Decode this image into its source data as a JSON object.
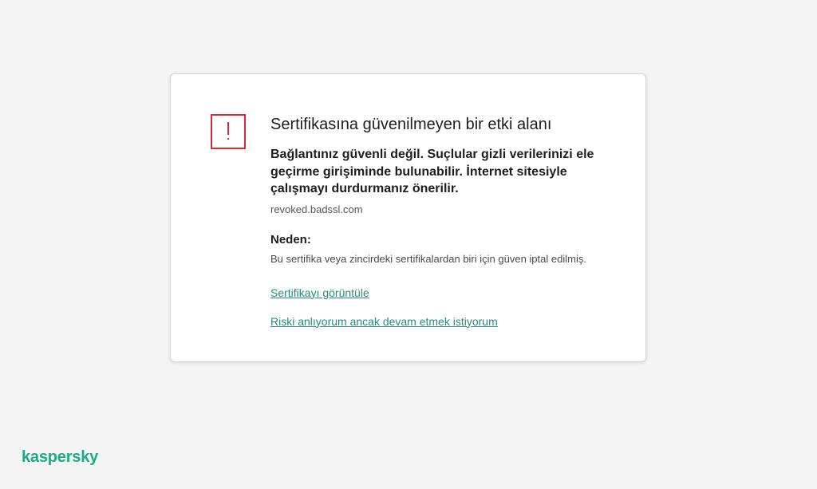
{
  "card": {
    "icon": "warning-icon",
    "title": "Sertifikasına güvenilmeyen bir etki alanı",
    "lead": "Bağlantınız güvenli değil. Suçlular gizli verilerinizi ele geçirme girişiminde bulunabilir. İnternet sitesiyle çalışmayı durdurmanız önerilir.",
    "domain": "revoked.badssl.com",
    "reason_label": "Neden:",
    "reason_text": "Bu sertifika veya zincirdeki sertifikalardan biri için güven iptal edilmiş.",
    "view_certificate_link": "Sertifikayı görüntüle",
    "continue_link": "Riski anlıyorum ancak devam etmek istiyorum"
  },
  "brand": {
    "logo_text": "kaspersky",
    "accent_color": "#1faa8c",
    "warning_color": "#d62c3a",
    "link_color": "#2a8a7a"
  }
}
